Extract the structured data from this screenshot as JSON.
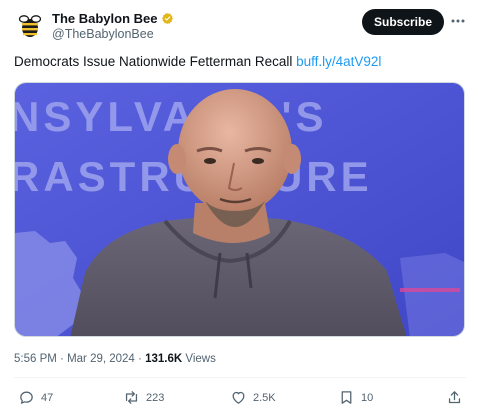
{
  "author": {
    "display_name": "The Babylon Bee",
    "handle": "@TheBabylonBee",
    "verified_color": "#e2b719"
  },
  "header": {
    "subscribe_label": "Subscribe"
  },
  "tweet": {
    "text": "Democrats Issue Nationwide Fetterman Recall",
    "link_text": "buff.ly/4atV92l"
  },
  "media": {
    "backdrop_text_line1": "NSYLVANIA'S",
    "backdrop_text_line2": "RASTRUCTURE",
    "backdrop_color": "#4d55d6"
  },
  "meta": {
    "time": "5:56 PM",
    "date": "Mar 29, 2024",
    "views_count": "131.6K",
    "views_label": "Views"
  },
  "actions": {
    "replies": "47",
    "reposts": "223",
    "likes": "2.5K",
    "bookmarks": "10"
  },
  "colors": {
    "link": "#1d9bf0",
    "text_secondary": "#536471",
    "subscribe_bg": "#0f1419"
  }
}
